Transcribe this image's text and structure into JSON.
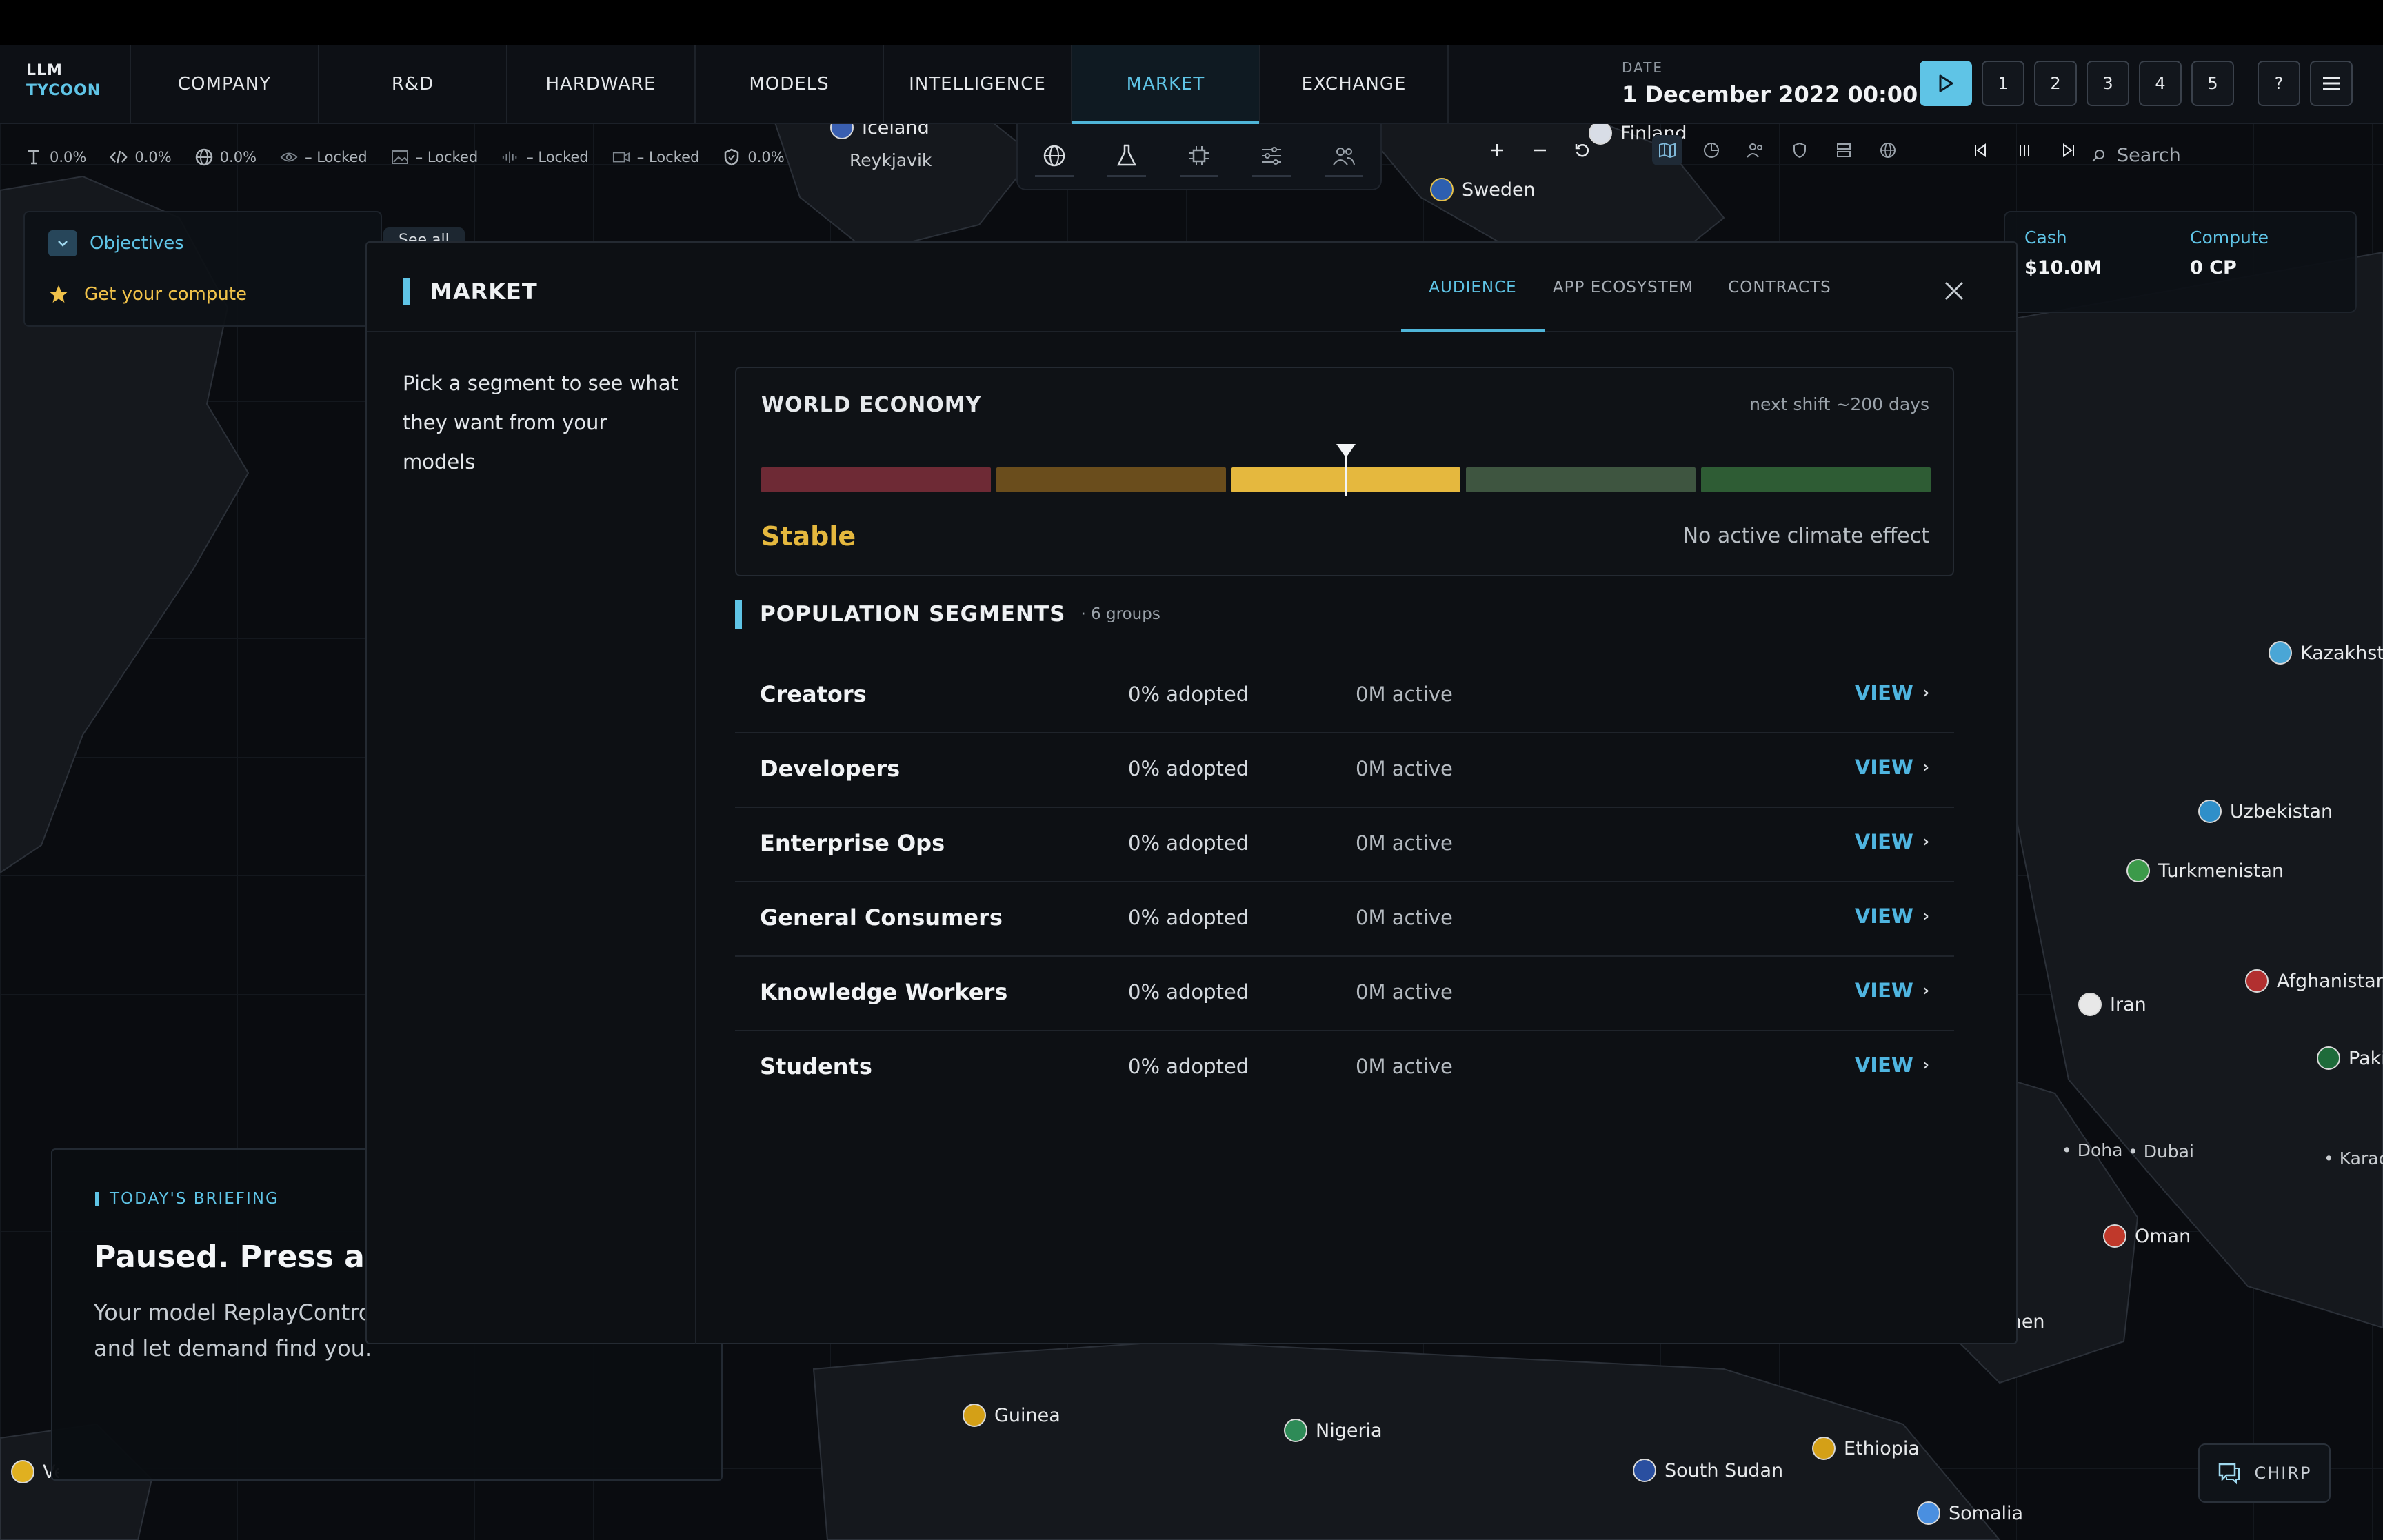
{
  "app": {
    "logo_line1": "LLM",
    "logo_line2": "TYCOON"
  },
  "nav": {
    "tabs": [
      {
        "label": "COMPANY"
      },
      {
        "label": "R&D"
      },
      {
        "label": "HARDWARE"
      },
      {
        "label": "MODELS"
      },
      {
        "label": "INTELLIGENCE"
      },
      {
        "label": "MARKET"
      },
      {
        "label": "EXCHANGE"
      }
    ],
    "active_tab": "MARKET",
    "date_label": "DATE",
    "date_value": "1 December 2022  00:00",
    "speeds": [
      "1",
      "2",
      "3",
      "4",
      "5"
    ],
    "help": "?"
  },
  "stats": [
    {
      "icon": "text-icon",
      "value": "0.0%"
    },
    {
      "icon": "code-icon",
      "value": "0.0%"
    },
    {
      "icon": "globe-icon",
      "value": "0.0%"
    },
    {
      "icon": "eye-icon",
      "value": "– Locked"
    },
    {
      "icon": "image-icon",
      "value": "– Locked"
    },
    {
      "icon": "audio-icon",
      "value": "– Locked"
    },
    {
      "icon": "video-icon",
      "value": "– Locked"
    },
    {
      "icon": "shield-icon",
      "value": "0.0%"
    }
  ],
  "search": {
    "placeholder": "Search"
  },
  "objectives": {
    "title": "Objectives",
    "goal": "Get your compute",
    "see_all": "See all"
  },
  "resources": {
    "cash_label": "Cash",
    "cash_value": "$10.0M",
    "compute_label": "Compute",
    "compute_value": "0 CP"
  },
  "briefing": {
    "label": "TODAY'S BRIEFING",
    "title": "Paused. Press a speed button to begin.",
    "body": "Your model ReplayControl is ready. Pick a daily tempo and let demand find you."
  },
  "market": {
    "title": "MARKET",
    "tabs": {
      "audience": "AUDIENCE",
      "apps": "APP ECOSYSTEM",
      "contracts": "CONTRACTS"
    },
    "hint": "Pick a segment to see what they want from your models",
    "economy": {
      "title": "WORLD ECONOMY",
      "next_shift": "next shift ~200 days",
      "state": "Stable",
      "climate": "No active climate effect",
      "level": 0.5,
      "colors": [
        "#6e2a35",
        "#6a4d1c",
        "#e5b83e",
        "#3e5540",
        "#2e5c34"
      ]
    },
    "segments_title": "POPULATION SEGMENTS",
    "segments_count": "· 6 groups",
    "segments": [
      {
        "name": "Creators",
        "adopted": "0% adopted",
        "active": "0M active",
        "view": "VIEW"
      },
      {
        "name": "Developers",
        "adopted": "0% adopted",
        "active": "0M active",
        "view": "VIEW"
      },
      {
        "name": "Enterprise Ops",
        "adopted": "0% adopted",
        "active": "0M active",
        "view": "VIEW"
      },
      {
        "name": "General Consumers",
        "adopted": "0% adopted",
        "active": "0M active",
        "view": "VIEW"
      },
      {
        "name": "Knowledge Workers",
        "adopted": "0% adopted",
        "active": "0M active",
        "view": "VIEW"
      },
      {
        "name": "Students",
        "adopted": "0% adopted",
        "active": "0M active",
        "view": "VIEW"
      }
    ]
  },
  "map": {
    "countries": [
      {
        "name": "Iceland",
        "flag": "#3a5fb0"
      },
      {
        "name": "Sweden",
        "flag": "#2d5fb0"
      },
      {
        "name": "Finland",
        "flag": "#d8dde6"
      },
      {
        "name": "Kazakhstan",
        "flag": "#4aa6d6"
      },
      {
        "name": "Uzbekistan",
        "flag": "#2f8fc9"
      },
      {
        "name": "Turkmenistan",
        "flag": "#3c9a4a"
      },
      {
        "name": "Iran",
        "flag": "#e8e8e8"
      },
      {
        "name": "Afghanistan",
        "flag": "#b23030"
      },
      {
        "name": "Pakistan",
        "flag": "#1e6b3a"
      },
      {
        "name": "Oman",
        "flag": "#c0392b"
      },
      {
        "name": "Yemen",
        "flag": "#c0392b"
      },
      {
        "name": "Guinea",
        "flag": "#d4a017"
      },
      {
        "name": "Nigeria",
        "flag": "#2e8b57"
      },
      {
        "name": "South Sudan",
        "flag": "#2a4fa0"
      },
      {
        "name": "Ethiopia",
        "flag": "#d4a017"
      },
      {
        "name": "Somalia",
        "flag": "#4a8fe0"
      },
      {
        "name": "Venezuela",
        "flag": "#e0b020"
      }
    ],
    "cities": [
      "Reykjavik",
      "Doha",
      "Dubai",
      "Karachi"
    ]
  },
  "chirp": {
    "label": "CHIRP"
  }
}
